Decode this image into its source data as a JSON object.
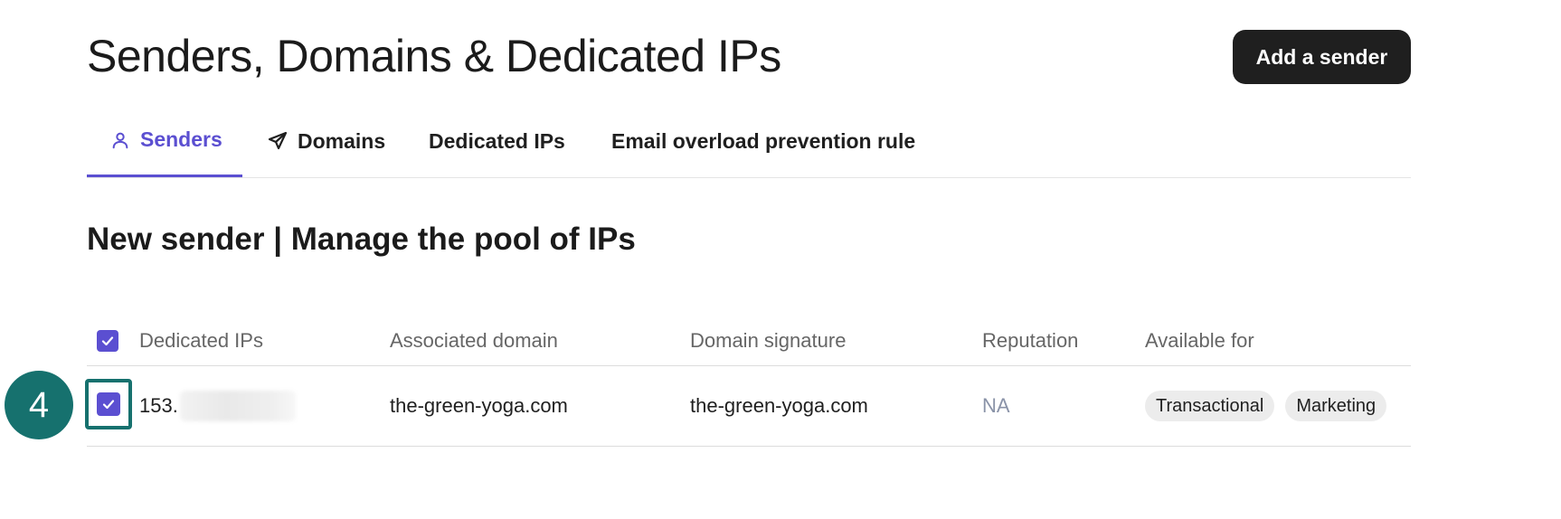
{
  "header": {
    "title": "Senders, Domains & Dedicated IPs",
    "add_button": "Add a sender"
  },
  "tabs": [
    {
      "label": "Senders",
      "icon": "user-icon",
      "active": true
    },
    {
      "label": "Domains",
      "icon": "send-icon",
      "active": false
    },
    {
      "label": "Dedicated IPs",
      "active": false
    },
    {
      "label": "Email overload prevention rule",
      "active": false
    }
  ],
  "section": {
    "title": "New sender | Manage the pool of IPs"
  },
  "table": {
    "select_all_checked": true,
    "columns": [
      "Dedicated IPs",
      "Associated domain",
      "Domain signature",
      "Reputation",
      "Available for"
    ],
    "rows": [
      {
        "checked": true,
        "ip": "153.",
        "associated_domain": "the-green-yoga.com",
        "domain_signature": "the-green-yoga.com",
        "reputation": "NA",
        "available_for": [
          "Transactional",
          "Marketing"
        ]
      }
    ]
  },
  "annotation": {
    "step": "4"
  },
  "colors": {
    "accent": "#5b4fd1",
    "annotation": "#16716e",
    "button_bg": "#1f1f1f",
    "muted": "#8a93a8"
  }
}
